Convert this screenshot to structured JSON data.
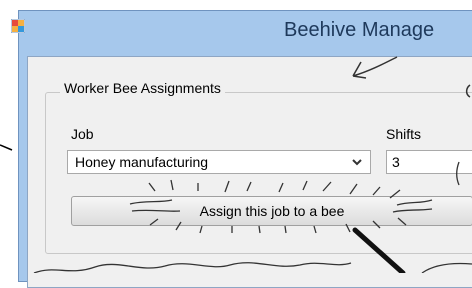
{
  "window": {
    "title": "Beehive Manage"
  },
  "group": {
    "legend": "Worker Bee Assignments"
  },
  "job": {
    "label": "Job",
    "selected": "Honey manufacturing"
  },
  "shifts": {
    "label": "Shifts",
    "value": "3"
  },
  "assign_button": {
    "label": "Assign this job to a bee"
  },
  "colors": {
    "title_bar": "#a6c8ec",
    "client_bg": "#f0f0f0",
    "title_text": "#1e395b"
  },
  "icons": {
    "app": "app-window-icon",
    "dropdown": "chevron-down-icon",
    "annotation": "hand-drawn-arrow-icon"
  }
}
